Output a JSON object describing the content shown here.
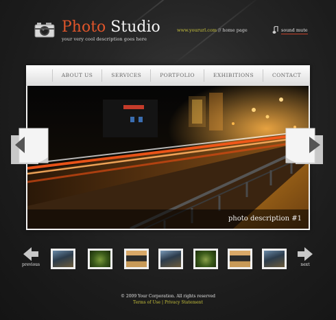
{
  "header": {
    "brand_part1": "Photo",
    "brand_part2": " Studio",
    "tagline": "your very cool description goes here",
    "url": "www.yoururl.com",
    "separator": " // ",
    "home_link": "home page",
    "sound_label": "sound mute"
  },
  "nav": {
    "items": [
      "ABOUT US",
      "SERVICES",
      "PORTFOLIO",
      "EXHIBITIONS",
      "CONTACT"
    ]
  },
  "slide": {
    "caption": "photo description #1"
  },
  "gallery": {
    "previous_label": "previous",
    "next_label": "next"
  },
  "footer": {
    "copyright": "© 2009 Your Corporation. All rights reserved",
    "terms": "Terms of Use",
    "divider": " | ",
    "privacy": "Privacy Statement"
  },
  "colors": {
    "accent_orange": "#e0552a",
    "link_yellow": "#c9c33c",
    "background": "#1b1b1b"
  }
}
